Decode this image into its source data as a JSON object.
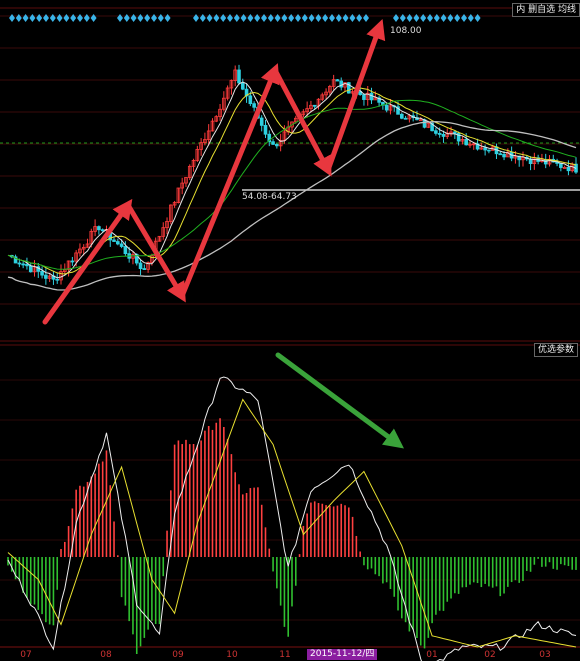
{
  "toolbar": {
    "top_label": "内  删自选  均线",
    "bottom_label": "优选参数"
  },
  "colors": {
    "background": "#000000",
    "up": "#ff3b3b",
    "down": "#2fd0e0",
    "ma_white": "#e6e6e6",
    "ma_yellow": "#e8e030",
    "ma_green": "#20b020",
    "hist_pos": "#ff4040",
    "hist_neg": "#30c030",
    "arrow_red": "#e8373e",
    "arrow_green": "#3aa33a",
    "signal_dots": "#3ab4e8",
    "dotted_guide": "#1a9a1a"
  },
  "annotations": {
    "high_label": "108.00",
    "range_label": "54.08-64.73",
    "cursor_date": "2015-11-12/四"
  },
  "chart_data": [
    {
      "type": "candlestick",
      "title": "",
      "x_tick_labels": [
        "07",
        "08",
        "09",
        "10",
        "11",
        "01",
        "02",
        "03"
      ],
      "price_points": [
        {
          "x": 0,
          "price": 62
        },
        {
          "x": 12,
          "price": 55
        },
        {
          "x": 24,
          "price": 70
        },
        {
          "x": 36,
          "price": 58
        },
        {
          "x": 46,
          "price": 82
        },
        {
          "x": 60,
          "price": 112
        },
        {
          "x": 70,
          "price": 92
        },
        {
          "x": 86,
          "price": 110
        },
        {
          "x": 110,
          "price": 98
        },
        {
          "x": 125,
          "price": 92
        },
        {
          "x": 140,
          "price": 88
        },
        {
          "x": 150,
          "price": 86
        }
      ],
      "annotated_high": 108.0,
      "horizontal_range": [
        54.08,
        64.73
      ]
    },
    {
      "type": "line",
      "title": "",
      "series": [
        {
          "name": "",
          "points": [
            {
              "x": 0,
              "v": -2
            },
            {
              "x": 6,
              "v": -20
            },
            {
              "x": 12,
              "v": -40
            },
            {
              "x": 18,
              "v": 15
            },
            {
              "x": 26,
              "v": 55
            },
            {
              "x": 34,
              "v": -20
            },
            {
              "x": 40,
              "v": -35
            },
            {
              "x": 44,
              "v": 20
            },
            {
              "x": 56,
              "v": 80
            },
            {
              "x": 66,
              "v": 70
            },
            {
              "x": 74,
              "v": -5
            },
            {
              "x": 80,
              "v": 30
            },
            {
              "x": 90,
              "v": 42
            },
            {
              "x": 100,
              "v": 5
            },
            {
              "x": 110,
              "v": -50
            },
            {
              "x": 120,
              "v": -40
            },
            {
              "x": 130,
              "v": -40
            },
            {
              "x": 140,
              "v": -30
            },
            {
              "x": 150,
              "v": -35
            }
          ]
        },
        {
          "name": "",
          "points": [
            {
              "x": 0,
              "v": 2
            },
            {
              "x": 8,
              "v": -10
            },
            {
              "x": 14,
              "v": -30
            },
            {
              "x": 22,
              "v": 10
            },
            {
              "x": 30,
              "v": 40
            },
            {
              "x": 38,
              "v": -10
            },
            {
              "x": 44,
              "v": -25
            },
            {
              "x": 50,
              "v": 15
            },
            {
              "x": 62,
              "v": 70
            },
            {
              "x": 70,
              "v": 50
            },
            {
              "x": 78,
              "v": 10
            },
            {
              "x": 86,
              "v": 25
            },
            {
              "x": 94,
              "v": 38
            },
            {
              "x": 104,
              "v": 5
            },
            {
              "x": 112,
              "v": -35
            },
            {
              "x": 124,
              "v": -40
            },
            {
              "x": 134,
              "v": -35
            },
            {
              "x": 150,
              "v": -40
            }
          ]
        }
      ],
      "histogram": "difference of the two series"
    }
  ]
}
